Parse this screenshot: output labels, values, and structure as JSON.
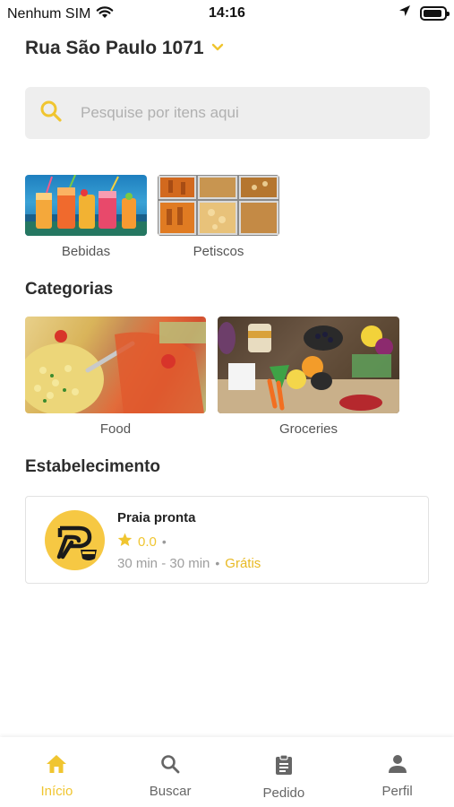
{
  "status_bar": {
    "carrier": "Nenhum SIM",
    "time": "14:16",
    "battery_level": 0.9
  },
  "header": {
    "address": "Rua São Paulo 1071",
    "chevron_icon": "chevron-down-icon"
  },
  "search": {
    "placeholder": "Pesquise por itens aqui",
    "icon": "search-icon"
  },
  "featured": [
    {
      "label": "Bebidas"
    },
    {
      "label": "Petiscos"
    }
  ],
  "categories": {
    "title": "Categorias",
    "items": [
      {
        "label": "Food"
      },
      {
        "label": "Groceries"
      }
    ]
  },
  "establishments": {
    "title": "Estabelecimento",
    "items": [
      {
        "name": "Praia pronta",
        "rating": "0.0",
        "delivery_time": "30 min - 30 min",
        "delivery_fee": "Grátis"
      }
    ]
  },
  "bottom_nav": {
    "items": [
      {
        "label": "Início",
        "icon": "home-icon",
        "active": true
      },
      {
        "label": "Buscar",
        "icon": "search-icon",
        "active": false
      },
      {
        "label": "Pedido",
        "icon": "clipboard-icon",
        "active": false
      },
      {
        "label": "Perfil",
        "icon": "person-icon",
        "active": false
      }
    ]
  },
  "colors": {
    "accent": "#f0c530",
    "text_dark": "#2d2d2d",
    "text_muted": "#9e9e9e",
    "search_bg": "#eeeeee"
  }
}
